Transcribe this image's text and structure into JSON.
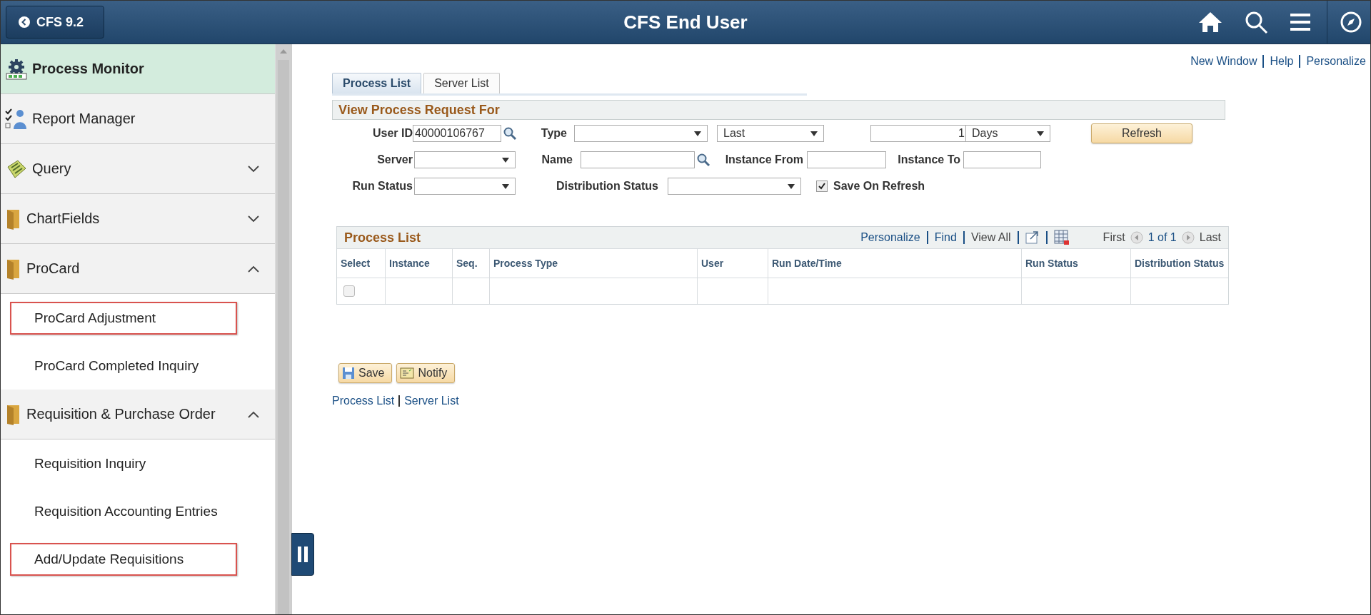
{
  "header": {
    "back_label": "CFS 9.2",
    "title": "CFS End User"
  },
  "sidebar": {
    "items": [
      {
        "label": "Process Monitor",
        "kind": "link",
        "selected": true
      },
      {
        "label": "Report Manager",
        "kind": "link",
        "selected": false
      },
      {
        "label": "Query",
        "kind": "folder",
        "expanded": false
      },
      {
        "label": "ChartFields",
        "kind": "folder",
        "expanded": false
      },
      {
        "label": "ProCard",
        "kind": "folder",
        "expanded": true,
        "children": [
          {
            "label": "ProCard Adjustment",
            "highlighted": true
          },
          {
            "label": "ProCard Completed Inquiry",
            "highlighted": false
          }
        ]
      },
      {
        "label": "Requisition & Purchase Order",
        "kind": "folder",
        "expanded": true,
        "children": [
          {
            "label": "Requisition Inquiry",
            "highlighted": false
          },
          {
            "label": "Requisition Accounting Entries",
            "highlighted": false
          },
          {
            "label": "Add/Update Requisitions",
            "highlighted": true
          }
        ]
      }
    ]
  },
  "top_links": [
    "New Window",
    "Help",
    "Personalize"
  ],
  "tabs": [
    {
      "label": "Process List",
      "selected": true
    },
    {
      "label": "Server List",
      "selected": false
    }
  ],
  "form": {
    "title": "View Process Request For",
    "user_id": {
      "label": "User ID",
      "value": "40000106767"
    },
    "type": {
      "label": "Type"
    },
    "period": {
      "value": "Last"
    },
    "count": {
      "value": "1"
    },
    "unit": {
      "value": "Days"
    },
    "refresh_button": "Refresh",
    "server": {
      "label": "Server"
    },
    "name": {
      "label": "Name"
    },
    "instance_from": {
      "label": "Instance From"
    },
    "instance_to": {
      "label": "Instance To"
    },
    "run_status": {
      "label": "Run Status"
    },
    "distribution_status": {
      "label": "Distribution Status"
    },
    "save_on_refresh": {
      "label": "Save On Refresh",
      "checked": true
    }
  },
  "grid": {
    "title": "Process List",
    "links": [
      "Personalize",
      "Find",
      "View All"
    ],
    "first": "First",
    "page": "1 of 1",
    "last": "Last",
    "columns": [
      "Select",
      "Instance",
      "Seq.",
      "Process Type",
      "User",
      "Run Date/Time",
      "Run Status",
      "Distribution Status"
    ],
    "rows": [
      {
        "checked": false
      }
    ]
  },
  "buttons": [
    "Save",
    "Notify"
  ],
  "bottom_links": [
    "Process List",
    "Server List"
  ]
}
